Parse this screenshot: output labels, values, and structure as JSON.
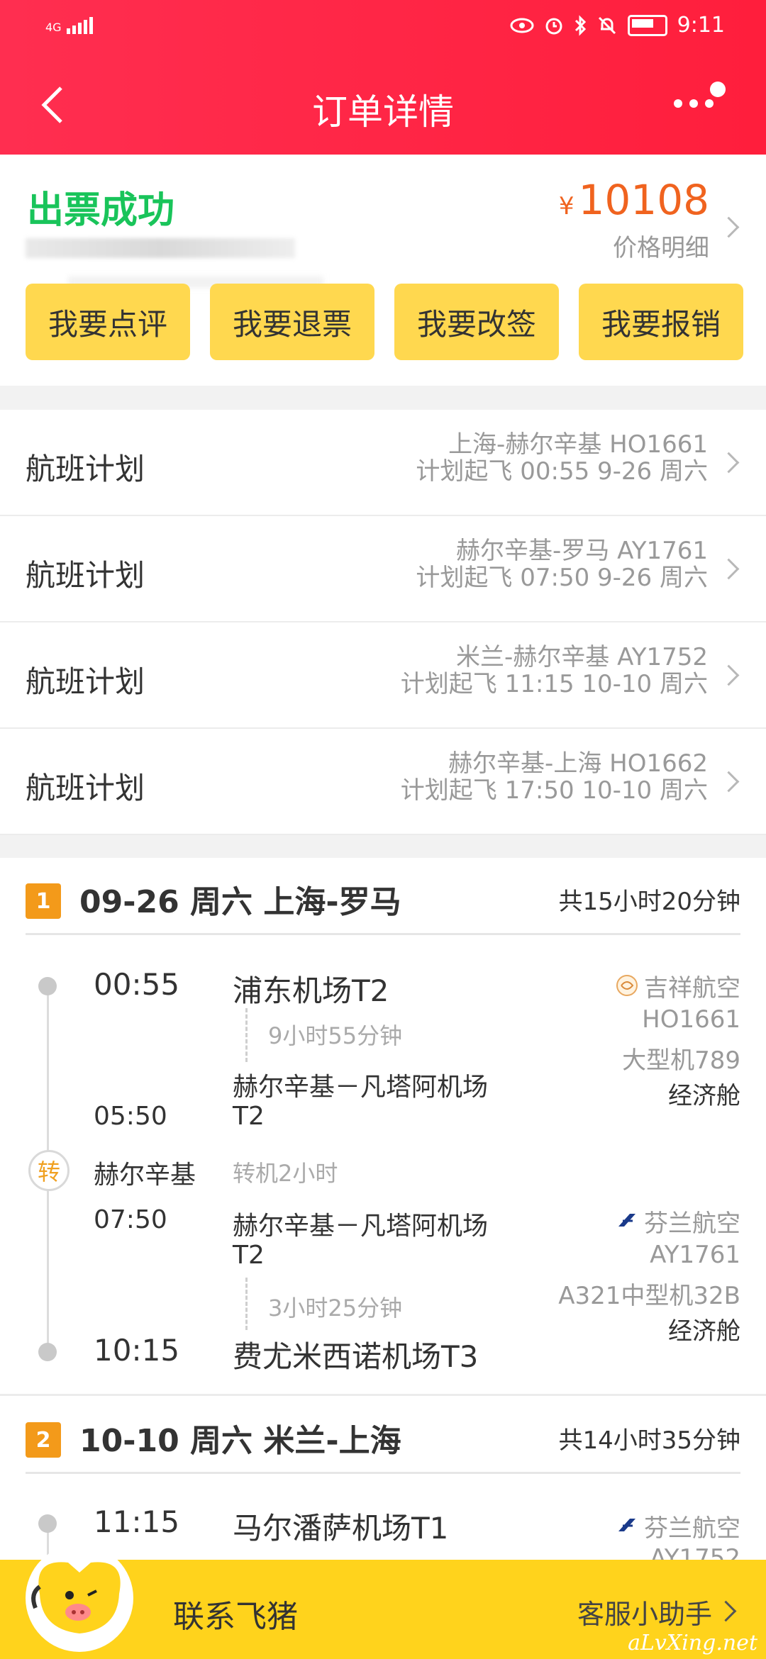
{
  "status_bar": {
    "network": "4G",
    "time": "9:11"
  },
  "header": {
    "title": "订单详情"
  },
  "summary": {
    "status": "出票成功",
    "currency": "¥",
    "price": "10108",
    "price_detail_label": "价格明细",
    "actions": [
      "我要点评",
      "我要退票",
      "我要改签",
      "我要报销"
    ]
  },
  "flight_plans": [
    {
      "label": "航班计划",
      "route": "上海-赫尔辛基 HO1661",
      "time": "计划起飞 00:55 9-26 周六"
    },
    {
      "label": "航班计划",
      "route": "赫尔辛基-罗马 AY1761",
      "time": "计划起飞 07:50 9-26 周六"
    },
    {
      "label": "航班计划",
      "route": "米兰-赫尔辛基 AY1752",
      "time": "计划起飞 11:15 10-10 周六"
    },
    {
      "label": "航班计划",
      "route": "赫尔辛基-上海 HO1662",
      "time": "计划起飞 17:50 10-10 周六"
    }
  ],
  "segments": [
    {
      "num": "1",
      "title": "09-26 周六 上海-罗马",
      "total": "共15小时20分钟",
      "legs": [
        {
          "dep_time": "00:55",
          "dep_airport": "浦东机场T2",
          "duration": "9小时55分钟",
          "arr_time": "05:50",
          "arr_airport_l1": "赫尔辛基－凡塔阿机场",
          "arr_airport_l2": "T2",
          "airline": "吉祥航空",
          "flight_no": "HO1661",
          "aircraft": "大型机789",
          "cabin": "经济舱"
        },
        {
          "dep_time": "07:50",
          "dep_airport_l1": "赫尔辛基－凡塔阿机场",
          "dep_airport_l2": "T2",
          "duration": "3小时25分钟",
          "arr_time": "10:15",
          "arr_airport": "费尤米西诺机场T3",
          "airline": "芬兰航空",
          "flight_no": "AY1761",
          "aircraft": "A321中型机32B",
          "cabin": "经济舱"
        }
      ],
      "transfer": {
        "icon": "转",
        "city": "赫尔辛基",
        "text": "转机2小时"
      }
    },
    {
      "num": "2",
      "title": "10-10 周六 米兰-上海",
      "total": "共14小时35分钟",
      "legs": [
        {
          "dep_time": "11:15",
          "dep_airport": "马尔潘萨机场T1",
          "airline": "芬兰航空",
          "flight_no": "AY1752"
        }
      ]
    }
  ],
  "bottom_bar": {
    "contact": "联系飞猪",
    "helper": "客服小助手",
    "watermark": "aLvXing.net"
  },
  "colors": {
    "header": "#ff2148",
    "success": "#19c45a",
    "price": "#f0631f",
    "button": "#ffd84f",
    "bottom": "#ffd31c",
    "badge": "#f39a1a"
  }
}
